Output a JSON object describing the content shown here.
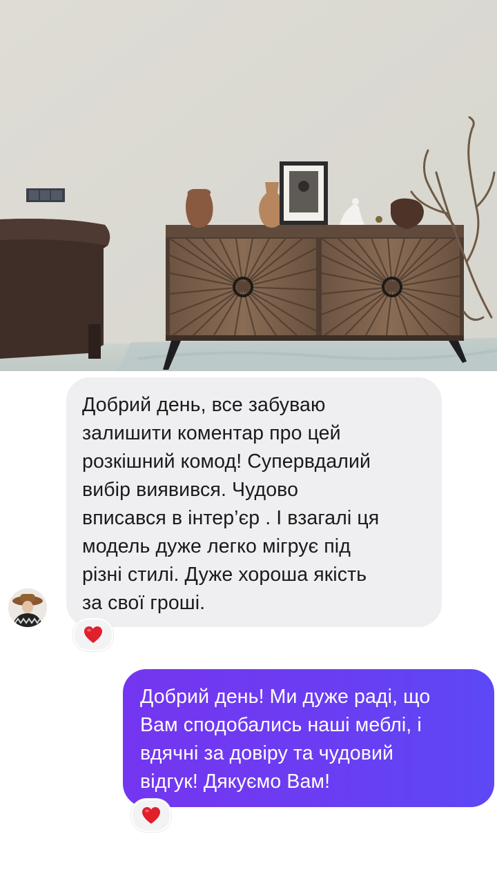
{
  "photo": {
    "description_icon": "sideboard-photo"
  },
  "chat": {
    "incoming": {
      "text": "Добрий день, все забуваю\nзалишити коментар про цей\nрозкішний комод! Супервдалий\nвибір виявився. Чудово\nвписався в інтер’єр . І взагалі ця\nмодель дуже легко мігрує під\nрізні стилі. Дуже хороша якість\nза свої гроші.",
      "reaction": "❤️",
      "bubble_color": "#efeff1"
    },
    "outgoing": {
      "text": "Добрий день! Ми дуже раді, що\nВам сподобались наші меблі, і\nвдячні за довіру та чудовий\nвідгук! Дякуємо Вам!",
      "reaction": "❤️",
      "bubble_color": "#6b3df2"
    },
    "heart_color": "#e0202b"
  }
}
